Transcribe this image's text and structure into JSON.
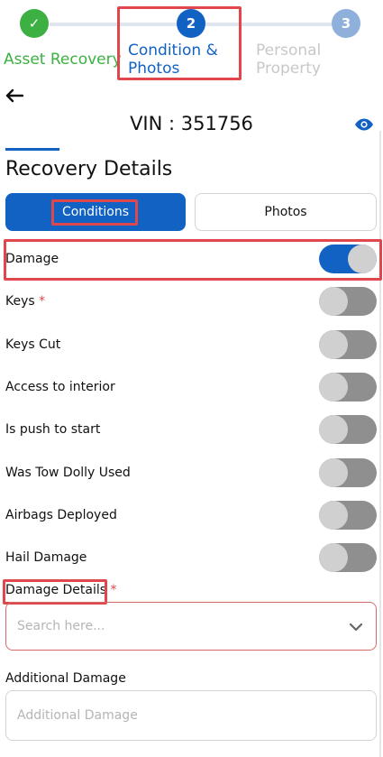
{
  "stepper": {
    "steps": [
      {
        "number": "✓",
        "label_lines": [
          "Asset Recovery"
        ],
        "state": "done",
        "color": "#3cb043"
      },
      {
        "number": "2",
        "label_lines": [
          "Condition &",
          "Photos"
        ],
        "state": "active",
        "color": "#1262c4"
      },
      {
        "number": "3",
        "label_lines": [
          "Personal",
          "Property"
        ],
        "state": "future",
        "color": "#8fb0da"
      }
    ]
  },
  "header": {
    "back_icon": "back-arrow-icon",
    "vin": "VIN : 351756",
    "view_icon": "eye-icon"
  },
  "section": {
    "title": "Recovery Details"
  },
  "tabs": [
    {
      "label": "Conditions",
      "active": true
    },
    {
      "label": "Photos",
      "active": false
    }
  ],
  "toggles": [
    {
      "label": "Damage",
      "required": "",
      "on": true
    },
    {
      "label": "Keys",
      "required": "*",
      "on": false
    },
    {
      "label": "Keys Cut",
      "required": "",
      "on": false
    },
    {
      "label": "Access to interior",
      "required": "",
      "on": false
    },
    {
      "label": "Is push to start",
      "required": "",
      "on": false
    },
    {
      "label": "Was Tow Dolly Used",
      "required": "",
      "on": false
    },
    {
      "label": "Airbags Deployed",
      "required": "",
      "on": false
    },
    {
      "label": "Hail Damage",
      "required": "",
      "on": false
    }
  ],
  "damage_details": {
    "label": "Damage Details",
    "required": "*",
    "placeholder": "Search here...",
    "icon": "chevron-down-icon"
  },
  "additional_damage": {
    "label": "Additional Damage",
    "placeholder": "Additional Damage"
  },
  "colors": {
    "primary": "#1262c4",
    "success": "#3cb043",
    "required": "#e0474c",
    "highlight_box": "#e0474c"
  }
}
